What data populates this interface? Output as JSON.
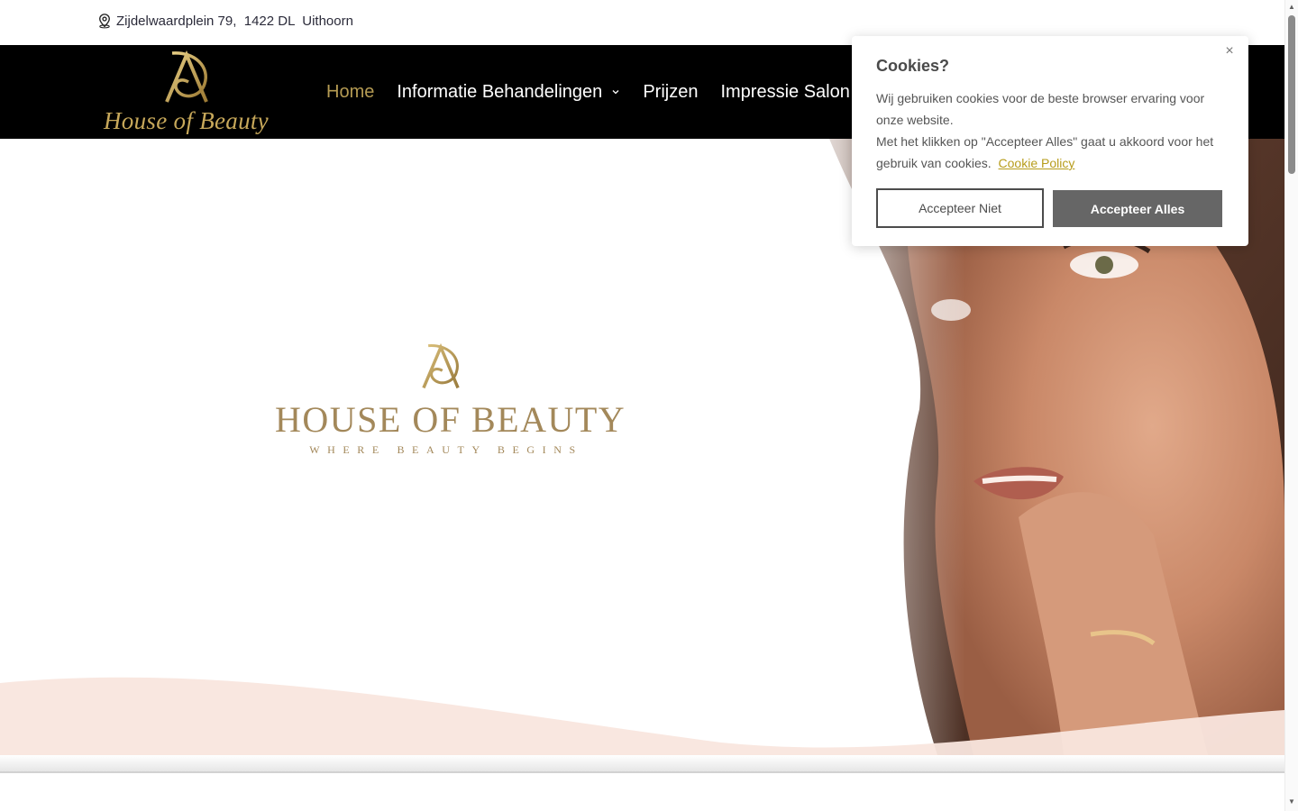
{
  "topbar": {
    "address": "Zijdelwaardplein 79,  1422 DL  Uithoorn",
    "address_icon": "location-pin-icon"
  },
  "navbar": {
    "brand_text": "House of Beauty",
    "menu": [
      {
        "label": "Home",
        "active": true
      },
      {
        "label": "Informatie Behandelingen",
        "has_dropdown": true
      },
      {
        "label": "Prijzen"
      },
      {
        "label": "Impressie Salon"
      }
    ]
  },
  "hero": {
    "title": "HOUSE OF BEAUTY",
    "tagline": "WHERE BEAUTY BEGINS"
  },
  "cookie": {
    "title": "Cookies?",
    "line1": "Wij gebruiken cookies voor de beste browser ervaring voor onze website.",
    "line2": "Met het klikken op \"Accepteer Alles\" gaat u akkoord voor het gebruik van cookies.",
    "policy_link": "Cookie Policy",
    "decline_label": "Accepteer Niet",
    "accept_label": "Accepteer Alles",
    "close_symbol": "×"
  },
  "colors": {
    "gold": "#b59b53",
    "nav_bg": "#000000",
    "wave": "#f9e6de",
    "link": "#b79c1b",
    "accept_bg": "#666666"
  }
}
